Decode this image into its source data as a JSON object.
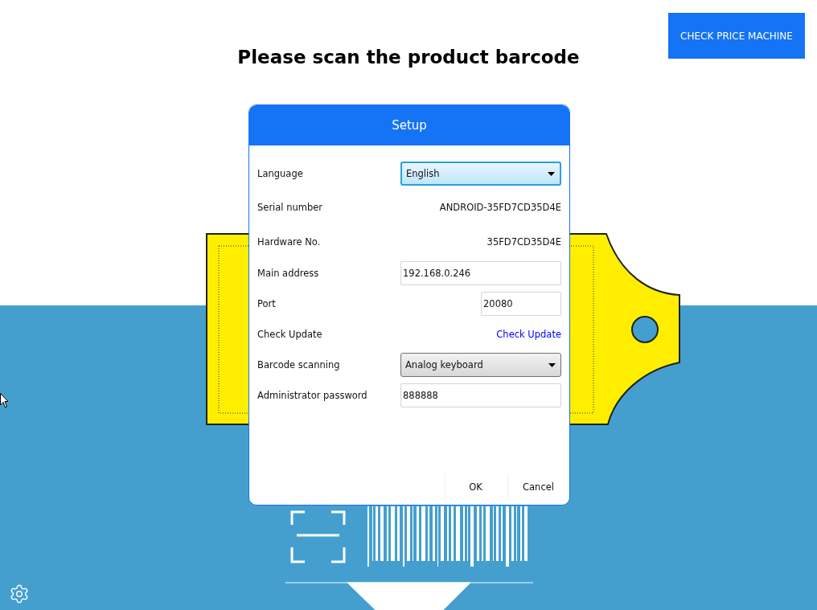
{
  "page_title": "Please scan the product barcode",
  "header_button": "CHECK PRICE MACHINE",
  "dialog": {
    "title": "Setup",
    "rows": [
      {
        "label": "Language",
        "kind": "select",
        "value": "English",
        "focused": true
      },
      {
        "label": "Serial number",
        "kind": "text",
        "value": "ANDROID-35FD7CD35D4E"
      },
      {
        "label": "Hardware No.",
        "kind": "text",
        "value": "35FD7CD35D4E"
      },
      {
        "label": "Main address",
        "kind": "input",
        "value": "192.168.0.246"
      },
      {
        "label": "Port",
        "kind": "short_input",
        "value": "20080"
      },
      {
        "label": "Check Update",
        "kind": "link",
        "value": "Check Update"
      },
      {
        "label": "Barcode scanning",
        "kind": "select",
        "value": "Analog keyboard",
        "focused": false
      },
      {
        "label": "Administrator password",
        "kind": "input",
        "value": "888888"
      }
    ],
    "buttons": [
      "OK",
      "Cancel"
    ]
  }
}
